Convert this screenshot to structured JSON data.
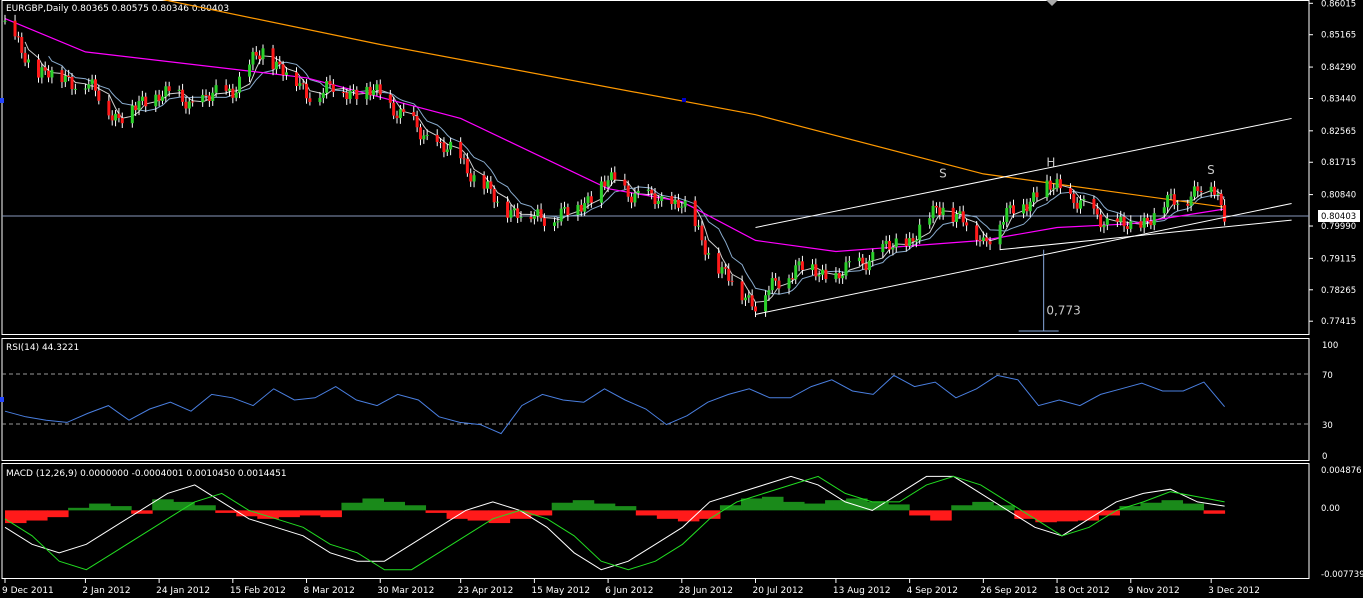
{
  "chart_data": [
    {
      "type": "candlestick",
      "title": "EURGBP,Daily  0.80365 0.80575 0.80346 0.80403",
      "symbol": "EURGBP",
      "timeframe": "Daily",
      "last_ohlc": {
        "open": 0.80365,
        "high": 0.80575,
        "low": 0.80346,
        "close": 0.80403
      },
      "current_price_label": "0.80403",
      "ylim": [
        0.7715,
        0.8605
      ],
      "y_ticks": [
        "0.86015",
        "0.85165",
        "0.84290",
        "0.83440",
        "0.82565",
        "0.81715",
        "0.80840",
        "0.79990",
        "0.79115",
        "0.78265",
        "0.77415"
      ],
      "x_ticks": [
        "9 Dec 2011",
        "2 Jan 2012",
        "24 Jan 2012",
        "15 Feb 2012",
        "8 Mar 2012",
        "30 Mar 2012",
        "23 Apr 2012",
        "15 May 2012",
        "6 Jun 2012",
        "28 Jun 2012",
        "20 Jul 2012",
        "13 Aug 2012",
        "4 Sep 2012",
        "26 Sep 2012",
        "18 Oct 2012",
        "9 Nov 2012",
        "3 Dec 2012"
      ],
      "close_path": [
        [
          "9 Dec 2011",
          0.8535
        ],
        [
          "18 Dec 2011",
          0.842
        ],
        [
          "2 Jan 2012",
          0.8385
        ],
        [
          "12 Jan 2012",
          0.829
        ],
        [
          "24 Jan 2012",
          0.836
        ],
        [
          "4 Feb 2012",
          0.833
        ],
        [
          "15 Feb 2012",
          0.837
        ],
        [
          "24 Feb 2012",
          0.8475
        ],
        [
          "8 Mar 2012",
          0.836
        ],
        [
          "18 Mar 2012",
          0.837
        ],
        [
          "30 Mar 2012",
          0.8355
        ],
        [
          "11 Apr 2012",
          0.825
        ],
        [
          "23 Apr 2012",
          0.818
        ],
        [
          "4 May 2012",
          0.806
        ],
        [
          "15 May 2012",
          0.802
        ],
        [
          "26 May 2012",
          0.8035
        ],
        [
          "6 Jun 2012",
          0.812
        ],
        [
          "18 Jun 2012",
          0.807
        ],
        [
          "28 Jun 2012",
          0.806
        ],
        [
          "10 Jul 2012",
          0.787
        ],
        [
          "20 Jul 2012",
          0.779
        ],
        [
          "1 Aug 2012",
          0.789
        ],
        [
          "13 Aug 2012",
          0.786
        ],
        [
          "24 Aug 2012",
          0.792
        ],
        [
          "4 Sep 2012",
          0.796
        ],
        [
          "14 Sep 2012",
          0.806
        ],
        [
          "26 Sep 2012",
          0.796
        ],
        [
          "7 Oct 2012",
          0.806
        ],
        [
          "18 Oct 2012",
          0.811
        ],
        [
          "28 Oct 2012",
          0.803
        ],
        [
          "9 Nov 2012",
          0.799
        ],
        [
          "20 Nov 2012",
          0.806
        ],
        [
          "3 Dec 2012",
          0.811
        ],
        [
          "7 Dec 2012",
          0.804
        ]
      ],
      "moving_averages": [
        {
          "color": "#ff9900",
          "points": [
            [
              "9 Dec 2011",
              0.87
            ],
            [
              "30 Mar 2012",
              0.849
            ],
            [
              "20 Jul 2012",
              0.83
            ],
            [
              "26 Sep 2012",
              0.814
            ],
            [
              "7 Dec 2012",
              0.805
            ]
          ]
        },
        {
          "color": "#ff00ff",
          "points": [
            [
              "9 Dec 2011",
              0.856
            ],
            [
              "2 Jan 2012",
              0.847
            ],
            [
              "8 Mar 2012",
              0.84
            ],
            [
              "23 Apr 2012",
              0.829
            ],
            [
              "6 Jun 2012",
              0.81
            ],
            [
              "28 Jun 2012",
              0.8065
            ],
            [
              "20 Jul 2012",
              0.796
            ],
            [
              "13 Aug 2012",
              0.793
            ],
            [
              "26 Sep 2012",
              0.796
            ],
            [
              "18 Oct 2012",
              0.7995
            ],
            [
              "9 Nov 2012",
              0.8005
            ],
            [
              "7 Dec 2012",
              0.8045
            ]
          ]
        }
      ],
      "annotations": [
        {
          "text": "S",
          "date": "14 Sep 2012",
          "price": 0.813
        },
        {
          "text": "H",
          "date": "16 Oct 2012",
          "price": 0.816
        },
        {
          "text": "S",
          "date": "3 Dec 2012",
          "price": 0.814
        },
        {
          "text": "0,773",
          "date": "16 Oct 2012",
          "price": 0.776
        }
      ],
      "trendlines": [
        {
          "from": [
            "20 Jul 2012",
            0.776
          ],
          "to": [
            "27 Dec 2012",
            0.806
          ]
        },
        {
          "from": [
            "20 Jul 2012",
            0.7995
          ],
          "to": [
            "27 Dec 2012",
            0.829
          ]
        },
        {
          "from": [
            "1 Oct 2012",
            0.7935
          ],
          "to": [
            "27 Dec 2012",
            0.8015
          ]
        }
      ]
    },
    {
      "type": "line",
      "title": "RSI(14) 44.3221",
      "ylim": [
        0,
        100
      ],
      "y_ticks": [
        "100",
        "70",
        "30",
        "0"
      ],
      "levels": [
        70,
        30
      ],
      "series": [
        {
          "name": "RSI(14)",
          "color": "#4a7fe0",
          "values": [
            40,
            35,
            32,
            30,
            38,
            45,
            32,
            42,
            48,
            40,
            55,
            52,
            45,
            60,
            50,
            52,
            62,
            50,
            45,
            55,
            50,
            35,
            30,
            28,
            20,
            45,
            55,
            50,
            48,
            60,
            50,
            42,
            28,
            36,
            48,
            55,
            60,
            52,
            52,
            62,
            68,
            58,
            55,
            72,
            62,
            66,
            52,
            60,
            72,
            68,
            45,
            50,
            45,
            55,
            60,
            65,
            58,
            58,
            66,
            44
          ]
        }
      ]
    },
    {
      "type": "bar_line",
      "title": "MACD  (12,26,9) 0.0000000 -0.0004001 0.0010450 0.0014451",
      "ylim": [
        -0.007739,
        0.004876
      ],
      "y_ticks": [
        "0.004876",
        "0.00",
        "-0.007739"
      ],
      "histogram": [
        -0.0015,
        -0.0012,
        -0.0008,
        0.0003,
        0.0008,
        0.0005,
        -0.0004,
        0.0013,
        0.001,
        0.0006,
        -0.0003,
        -0.0007,
        -0.001,
        -0.0008,
        -0.0006,
        -0.0008,
        0.0009,
        0.0014,
        0.001,
        0.0006,
        -0.0003,
        -0.001,
        -0.0012,
        -0.0015,
        -0.001,
        -0.0006,
        0.0009,
        0.0012,
        0.0008,
        0.0005,
        -0.0006,
        -0.001,
        -0.0013,
        -0.001,
        0.0006,
        0.0014,
        0.0016,
        0.001,
        0.0008,
        0.0012,
        0.0014,
        0.001,
        0.0007,
        -0.0006,
        -0.0012,
        0.0006,
        0.001,
        0.0006,
        -0.001,
        -0.0014,
        -0.0013,
        -0.0012,
        -0.0006,
        0.0005,
        0.0009,
        0.0012,
        0.0008,
        -0.0004
      ],
      "series": [
        {
          "name": "MACD",
          "color": "#ffffff",
          "values": [
            -0.002,
            -0.004,
            -0.005,
            -0.004,
            -0.002,
            0.0,
            0.002,
            0.003,
            0.001,
            -0.001,
            -0.002,
            -0.003,
            -0.005,
            -0.006,
            -0.006,
            -0.004,
            -0.002,
            0.0,
            0.001,
            0.0,
            -0.002,
            -0.005,
            -0.007,
            -0.006,
            -0.004,
            -0.002,
            0.001,
            0.002,
            0.003,
            0.004,
            0.003,
            0.001,
            0.0,
            0.002,
            0.004,
            0.004,
            0.002,
            0.0,
            -0.002,
            -0.003,
            -0.001,
            0.001,
            0.002,
            0.0025,
            0.001,
            0.0005
          ]
        },
        {
          "name": "Signal",
          "color": "#22dd22",
          "values": [
            -0.001,
            -0.003,
            -0.006,
            -0.007,
            -0.005,
            -0.003,
            -0.001,
            0.001,
            0.002,
            0.0,
            -0.001,
            -0.002,
            -0.004,
            -0.005,
            -0.007,
            -0.007,
            -0.005,
            -0.003,
            -0.001,
            0.0,
            -0.001,
            -0.003,
            -0.006,
            -0.007,
            -0.006,
            -0.004,
            -0.001,
            0.001,
            0.002,
            0.003,
            0.004,
            0.002,
            0.001,
            0.001,
            0.003,
            0.004,
            0.003,
            0.001,
            -0.001,
            -0.003,
            -0.002,
            0.0,
            0.001,
            0.0022,
            0.0016,
            0.001
          ]
        }
      ]
    }
  ]
}
